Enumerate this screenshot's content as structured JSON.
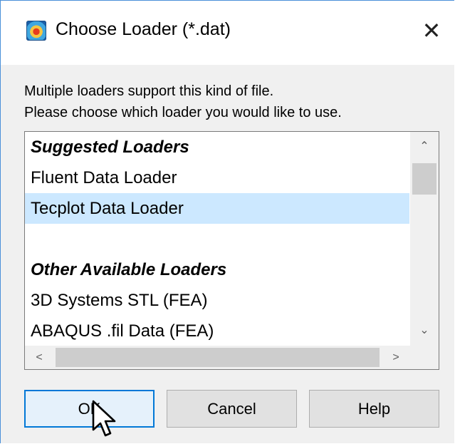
{
  "window": {
    "title": "Choose Loader (*.dat)",
    "close_label": "✕"
  },
  "instructions": {
    "line1": "Multiple loaders support this kind of file.",
    "line2": "Please choose which loader you would like to use."
  },
  "list": {
    "items": [
      {
        "label": "Suggested Loaders",
        "kind": "header"
      },
      {
        "label": "Fluent Data Loader",
        "kind": "item"
      },
      {
        "label": "Tecplot Data Loader",
        "kind": "item",
        "selected": true
      },
      {
        "label": "",
        "kind": "blank"
      },
      {
        "label": "Other Available Loaders",
        "kind": "header"
      },
      {
        "label": "3D Systems STL (FEA)",
        "kind": "item"
      },
      {
        "label": "ABAQUS .fil Data (FEA)",
        "kind": "item"
      }
    ],
    "scroll_up": "⌃",
    "scroll_down": "⌄",
    "scroll_left": "<",
    "scroll_right": ">"
  },
  "buttons": {
    "ok": "OK",
    "cancel": "Cancel",
    "help": "Help"
  },
  "colors": {
    "selection": "#cce8ff",
    "accent": "#0078d7"
  }
}
